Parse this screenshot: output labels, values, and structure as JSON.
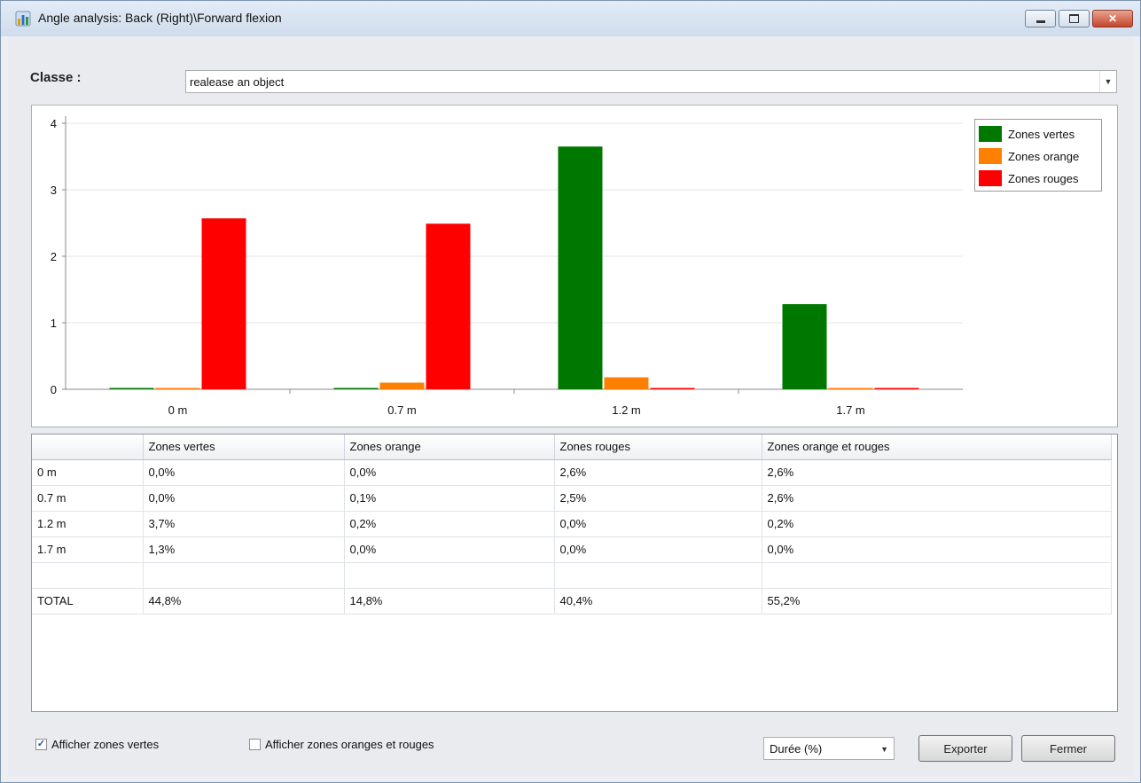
{
  "window": {
    "title": "Angle analysis: Back (Right)\\Forward flexion",
    "min_glyph": "",
    "close_glyph": "✕"
  },
  "classe": {
    "label": "Classe :",
    "value": "realease an object"
  },
  "legend": {
    "items": [
      {
        "label": "Zones vertes",
        "color": "#007800"
      },
      {
        "label": "Zones orange",
        "color": "#ff8000"
      },
      {
        "label": "Zones rouges",
        "color": "#ff0000"
      }
    ]
  },
  "chart_data": {
    "type": "bar",
    "categories": [
      "0 m",
      "0.7 m",
      "1.2 m",
      "1.7 m"
    ],
    "series": [
      {
        "name": "Zones vertes",
        "color": "#007800",
        "values": [
          0.0,
          0.0,
          3.65,
          1.28
        ]
      },
      {
        "name": "Zones orange",
        "color": "#ff8000",
        "values": [
          0.0,
          0.1,
          0.18,
          0.0
        ]
      },
      {
        "name": "Zones rouges",
        "color": "#ff0000",
        "values": [
          2.57,
          2.49,
          0.0,
          0.0
        ]
      }
    ],
    "yticks": [
      "0",
      "1",
      "2",
      "3",
      "4"
    ],
    "ylim": [
      0,
      4
    ],
    "grid": true,
    "legend_position": "top-right"
  },
  "table": {
    "headers": [
      "",
      "Zones vertes",
      "Zones orange",
      "Zones rouges",
      "Zones orange et rouges"
    ],
    "rows": [
      [
        "0 m",
        "0,0%",
        "0,0%",
        "2,6%",
        "2,6%"
      ],
      [
        "0.7 m",
        "0,0%",
        "0,1%",
        "2,5%",
        "2,6%"
      ],
      [
        "1.2 m",
        "3,7%",
        "0,2%",
        "0,0%",
        "0,2%"
      ],
      [
        "1.7 m",
        "1,3%",
        "0,0%",
        "0,0%",
        "0,0%"
      ],
      [
        "",
        "",
        "",
        "",
        ""
      ],
      [
        "TOTAL",
        "44,8%",
        "14,8%",
        "40,4%",
        "55,2%"
      ]
    ]
  },
  "footer": {
    "show_green_label": "Afficher zones vertes",
    "show_green_checked": true,
    "show_orange_red_label": "Afficher zones oranges et rouges",
    "show_orange_red_checked": false,
    "duree_value": "Durée (%)",
    "export_label": "Exporter",
    "close_label": "Fermer"
  }
}
